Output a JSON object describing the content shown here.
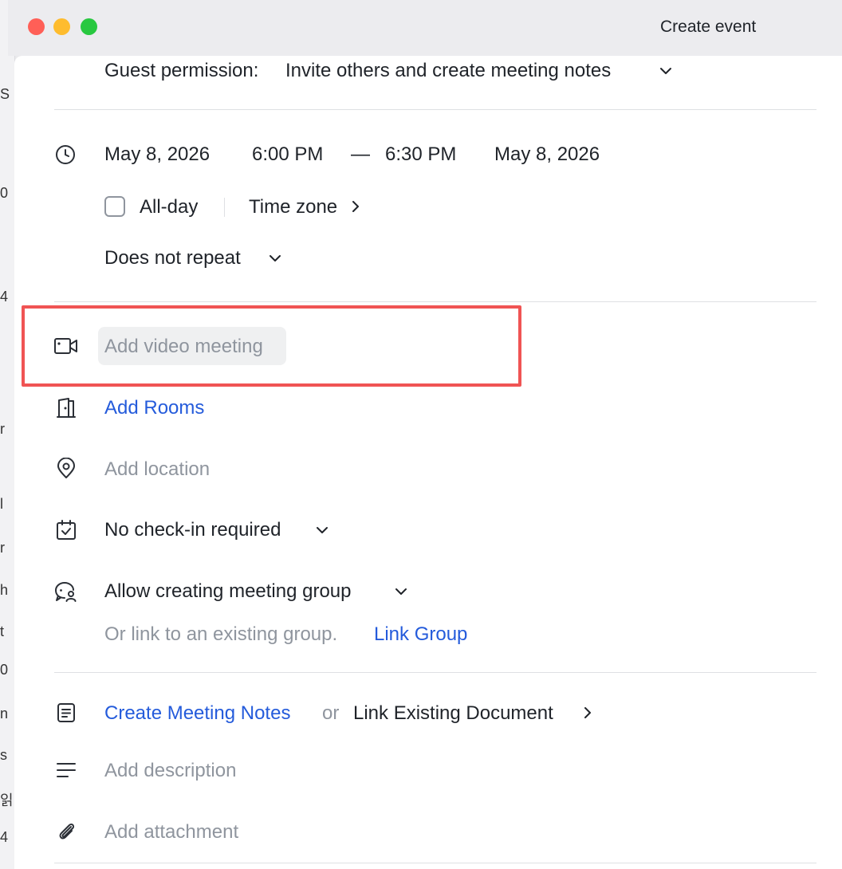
{
  "window": {
    "title": "Create event",
    "traffic_lights": {
      "close": "#ff5f57",
      "minimize": "#febc2e",
      "zoom": "#28c840"
    }
  },
  "background_fragments": [
    "S",
    "0",
    "4",
    "r",
    "l",
    "r",
    "h",
    "t",
    "0",
    "n",
    "s",
    "읽",
    "4"
  ],
  "guest_permission": {
    "label": "Guest permission:",
    "value": "Invite others and create meeting notes"
  },
  "time": {
    "start_date": "May 8, 2026",
    "start_time": "6:00 PM",
    "dash": "—",
    "end_time": "6:30 PM",
    "end_date": "May 8, 2026",
    "all_day_label": "All-day",
    "all_day_checked": false,
    "time_zone_label": "Time zone",
    "repeat_value": "Does not repeat"
  },
  "video": {
    "placeholder": "Add video meeting"
  },
  "rooms": {
    "label": "Add Rooms"
  },
  "location": {
    "placeholder": "Add location"
  },
  "checkin": {
    "value": "No check-in required"
  },
  "group": {
    "value": "Allow creating meeting group",
    "hint": "Or link to an existing group.",
    "link_label": "Link Group"
  },
  "notes": {
    "create_label": "Create Meeting Notes",
    "or": "or",
    "link_label": "Link Existing Document"
  },
  "description": {
    "placeholder": "Add description"
  },
  "attachment": {
    "placeholder": "Add attachment"
  },
  "icons": {
    "time": "clock-icon",
    "video": "video-camera-icon",
    "rooms": "door-icon",
    "location": "location-pin-icon",
    "checkin": "calendar-check-icon",
    "group": "chat-group-icon",
    "notes": "document-icon",
    "description": "text-lines-icon",
    "attachment": "paperclip-icon"
  },
  "colors": {
    "accent": "#245bdb",
    "highlight": "#f05454",
    "muted": "#8f959e",
    "text": "#1f2329"
  }
}
